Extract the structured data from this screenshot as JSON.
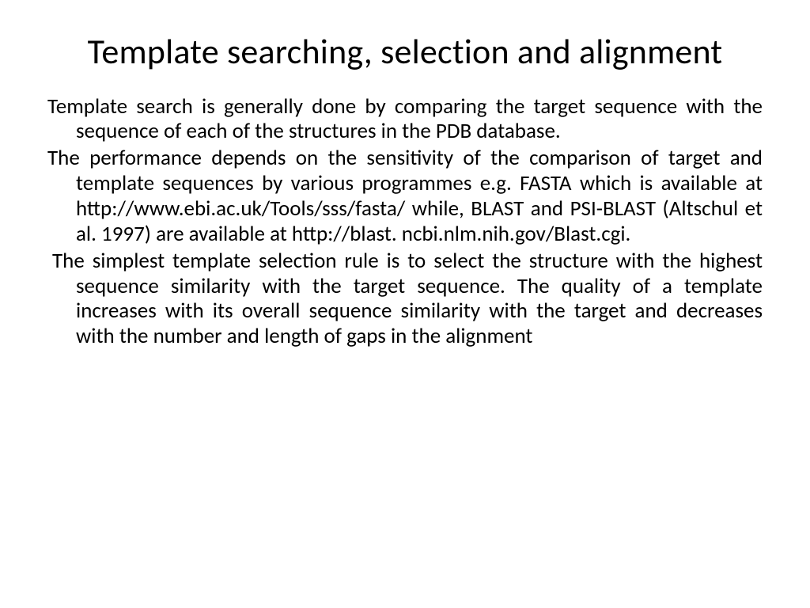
{
  "slide": {
    "title": "Template searching, selection and alignment",
    "paragraphs": [
      "Template search is generally done by comparing the target sequence with the sequence of each of the structures in the PDB database.",
      "The performance depends on the sensitivity of the comparison of target and template sequences by various programmes e.g. FASTA which is available at http://www.ebi.ac.uk/Tools/sss/fasta/ while, BLAST and PSI-BLAST (Altschul et al. 1997) are available at http://blast. ncbi.nlm.nih.gov/Blast.cgi.",
      "The simplest template selection rule is to select the structure with the highest sequence similarity with the target sequence. The quality of a template increases with its overall sequence similarity with the target and decreases with the number and length of gaps in the alignment"
    ]
  }
}
